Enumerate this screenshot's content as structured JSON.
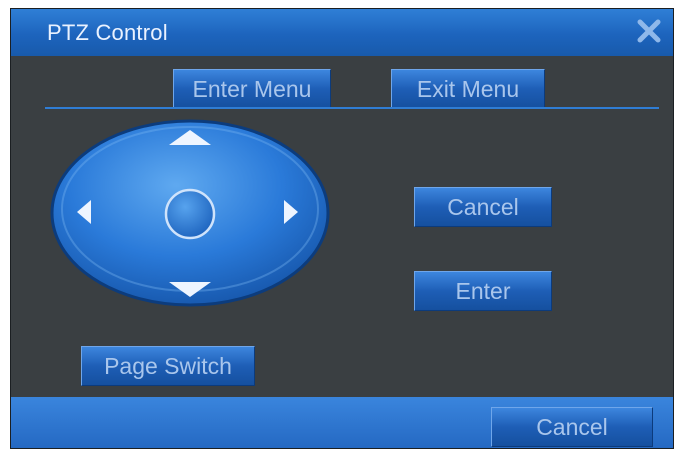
{
  "window": {
    "title": "PTZ Control"
  },
  "menu": {
    "enter_menu": "Enter Menu",
    "exit_menu": "Exit Menu"
  },
  "controls": {
    "cancel": "Cancel",
    "enter": "Enter",
    "page_switch": "Page Switch"
  },
  "footer": {
    "cancel": "Cancel"
  },
  "icons": {
    "close": "close-icon",
    "up": "arrow-up-icon",
    "down": "arrow-down-icon",
    "left": "arrow-left-icon",
    "right": "arrow-right-icon",
    "center": "center-circle-icon"
  },
  "colors": {
    "title_bar": "#1d64bd",
    "panel": "#3a3f42",
    "button": "#1e5eb6",
    "button_text": "#a9c6ec"
  }
}
